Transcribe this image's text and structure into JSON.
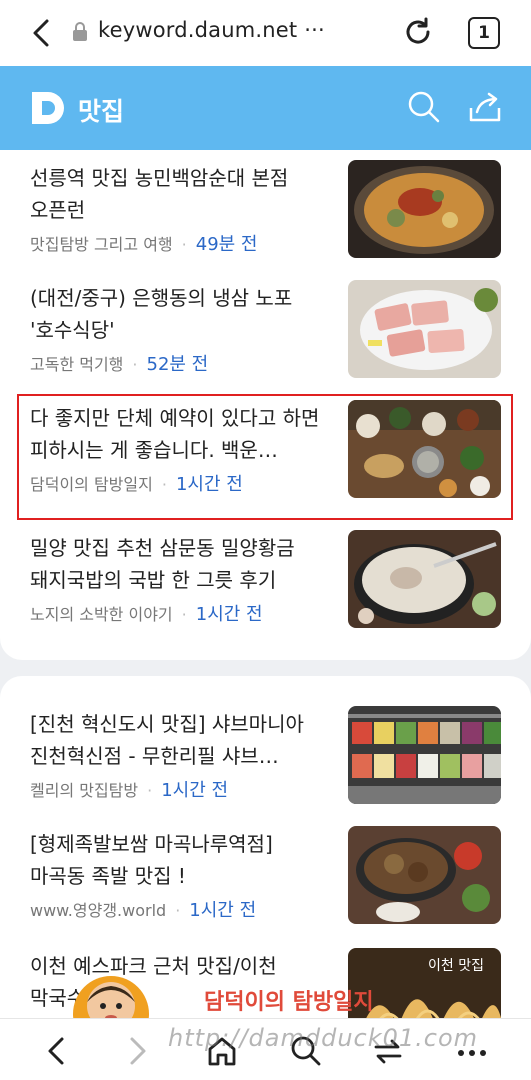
{
  "browser": {
    "url": "keyword.daum.net ···",
    "tab_count": "1"
  },
  "header": {
    "title": "맛집"
  },
  "articles_card1": [
    {
      "title": "선릉역 맛집 농민백암순대 본점 오픈런",
      "source": "맛집탐방 그리고 여행",
      "time": "49분 전"
    },
    {
      "title": "(대전/중구) 은행동의 냉삼 노포 '호수식당'",
      "source": "고독한 먹기행",
      "time": "52분 전"
    },
    {
      "title": "다 좋지만 단체 예약이 있다고 하면 피하시는 게 좋습니다. 백운…",
      "source": "담덕이의 탐방일지",
      "time": "1시간 전"
    },
    {
      "title": "밀양 맛집 추천 삼문동 밀양황금 돼지국밥의 국밥 한 그릇 후기",
      "source": "노지의 소박한 이야기",
      "time": "1시간 전"
    }
  ],
  "articles_card2": [
    {
      "title": "[진천 혁신도시 맛집] 샤브마니아 진천혁신점 - 무한리필 샤브…",
      "source": "켈리의 맛집탐방",
      "time": "1시간 전"
    },
    {
      "title": "[형제족발보쌈 마곡나루역점] 마곡동 족발 맛집 !",
      "source": "www.영양갱.world",
      "time": "1시간 전"
    },
    {
      "title": "이천 예스파크 근처 맛집/이천 막국수",
      "source": "",
      "time": ""
    }
  ],
  "watermark": {
    "text": "담덕이의 탐방일지",
    "url": "http://damdduck01.com"
  },
  "colors": {
    "header_bg": "#5fb8f0",
    "time_blue": "#2b68c7",
    "highlight_red": "#e02020"
  }
}
